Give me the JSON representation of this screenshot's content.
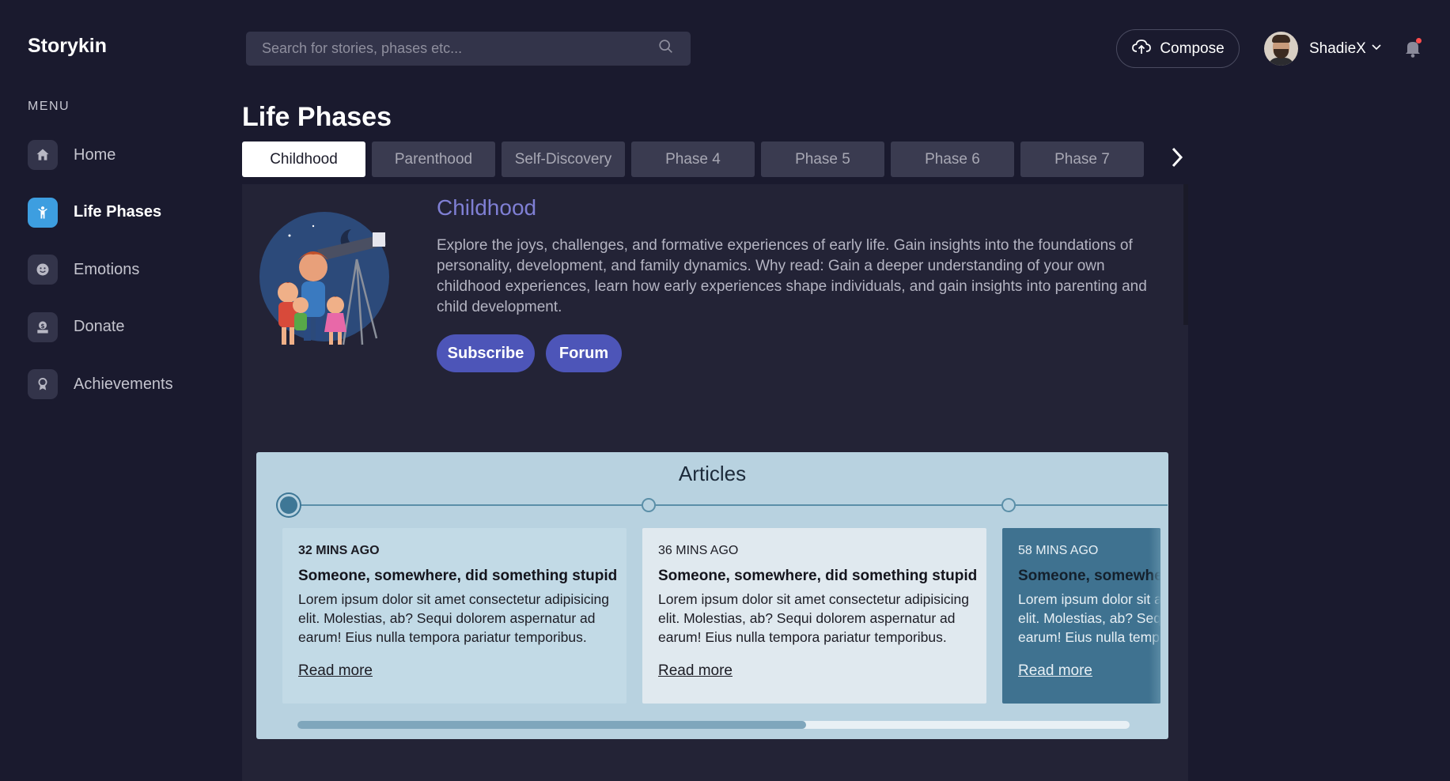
{
  "app": {
    "brand": "Storykin"
  },
  "sidebar": {
    "menu_title": "MENU",
    "items": [
      {
        "label": "Home",
        "icon": "home-icon",
        "active": false
      },
      {
        "label": "Life Phases",
        "icon": "person-icon",
        "active": true
      },
      {
        "label": "Emotions",
        "icon": "smiley-icon",
        "active": false
      },
      {
        "label": "Donate",
        "icon": "donate-icon",
        "active": false
      },
      {
        "label": "Achievements",
        "icon": "award-icon",
        "active": false
      }
    ]
  },
  "header": {
    "search_placeholder": "Search for stories, phases etc...",
    "compose_label": "Compose",
    "username": "ShadieX"
  },
  "page": {
    "title": "Life Phases",
    "tabs": [
      "Childhood",
      "Parenthood",
      "Self-Discovery",
      "Phase 4",
      "Phase 5",
      "Phase 6",
      "Phase 7"
    ],
    "active_tab": "Childhood"
  },
  "phase": {
    "title": "Childhood",
    "description": "Explore the joys, challenges, and formative experiences of early life. Gain insights into the foundations of personality, development, and family dynamics. Why read: Gain a deeper understanding of your own childhood experiences, learn how early experiences shape individuals, and gain insights into parenting and child development.",
    "subscribe_label": "Subscribe",
    "forum_label": "Forum"
  },
  "articles": {
    "title": "Articles",
    "items": [
      {
        "time": "32 MINS AGO",
        "title": "Someone, somewhere, did something stupid",
        "body": "Lorem ipsum dolor sit amet consectetur adipisicing elit. Molestias, ab? Sequi dolorem aspernatur ad earum! Eius nulla tempora pariatur temporibus.",
        "link": "Read more"
      },
      {
        "time": "36 MINS AGO",
        "title": "Someone, somewhere, did something stupid",
        "body": "Lorem ipsum dolor sit amet consectetur adipisicing elit. Molestias, ab? Sequi dolorem aspernatur ad earum! Eius nulla tempora pariatur temporibus.",
        "link": "Read more"
      },
      {
        "time": "58 MINS AGO",
        "title": "Someone, somewhere, did something stupid",
        "body": "Lorem ipsum dolor sit amet consectetur adipisicing elit. Molestias, ab? Sequi dolorem aspernatur ad earum! Eius nulla tempora pariatur temporibus.",
        "link": "Read more"
      }
    ]
  },
  "colors": {
    "background": "#1a1a2e",
    "accent": "#4d55b8",
    "active_nav": "#3d9ee0",
    "articles_panel": "#b8d2e0"
  }
}
